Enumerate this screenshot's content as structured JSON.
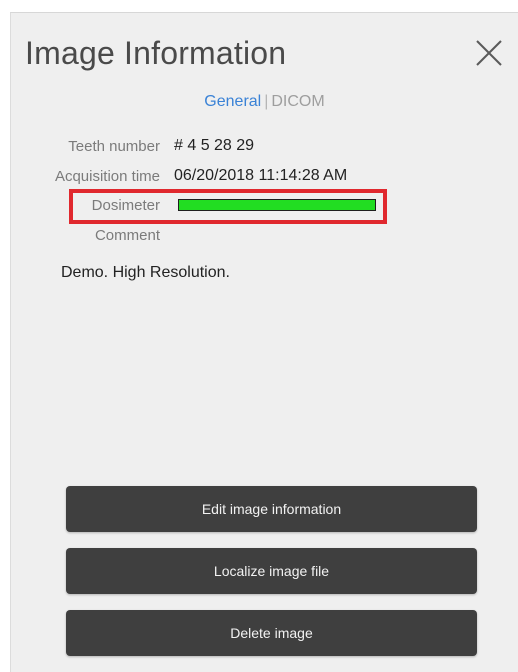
{
  "panel": {
    "title": "Image Information"
  },
  "tabs": {
    "general": "General",
    "separator": "|",
    "dicom": "DICOM"
  },
  "fields": {
    "teeth_number_label": "Teeth number",
    "teeth_number_value": "# 4 5 28 29",
    "acquisition_time_label": "Acquisition time",
    "acquisition_time_value": "06/20/2018 11:14:28 AM",
    "dosimeter_label": "Dosimeter",
    "dosimeter_level": 1.0,
    "comment_label": "Comment",
    "comment_value": "Demo. High Resolution."
  },
  "buttons": {
    "edit": "Edit image information",
    "localize": "Localize image file",
    "delete": "Delete image"
  },
  "colors": {
    "accent_tab": "#3a82d6",
    "dosimeter_fill": "#22dd22",
    "highlight": "#e0282e",
    "button_bg": "#3f3f3f"
  },
  "icons": {
    "close": "close-icon"
  }
}
